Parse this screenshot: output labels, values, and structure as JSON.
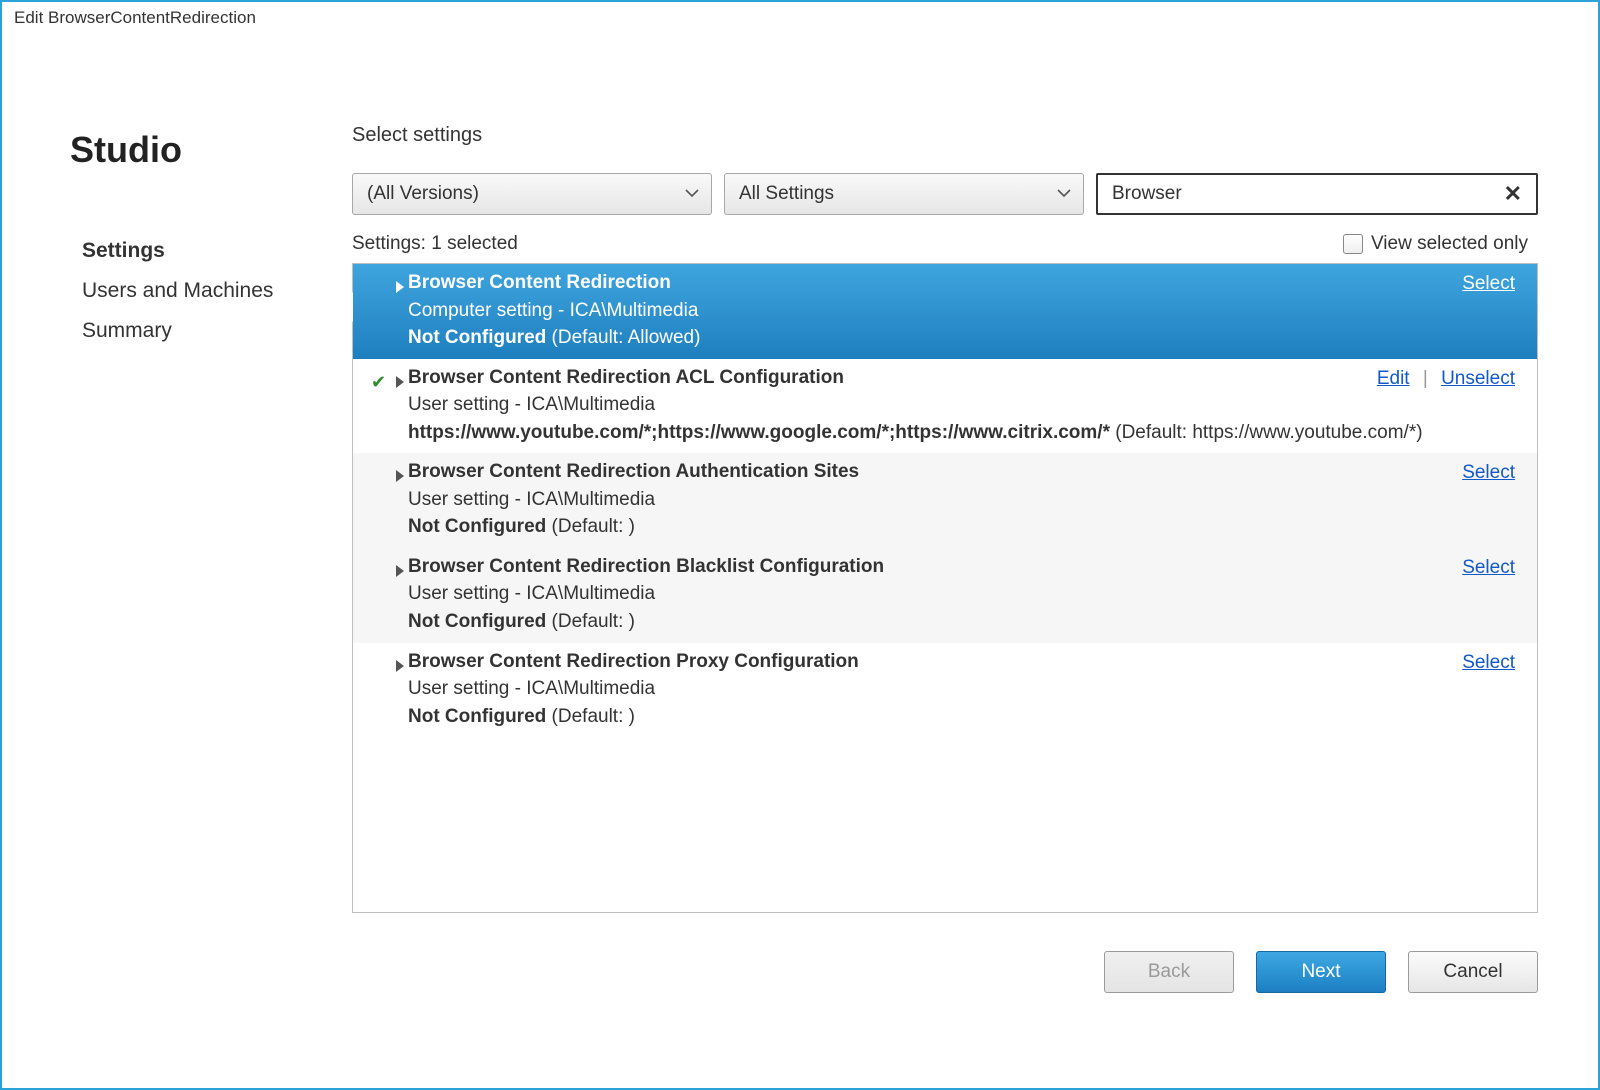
{
  "window": {
    "title": "Edit BrowserContentRedirection"
  },
  "sidebar": {
    "brand": "Studio",
    "items": [
      {
        "label": "Settings",
        "active": true
      },
      {
        "label": "Users and Machines",
        "active": false
      },
      {
        "label": "Summary",
        "active": false
      }
    ]
  },
  "main": {
    "section_title": "Select settings",
    "version_dropdown": "(All Versions)",
    "scope_dropdown": "All Settings",
    "search_value": "Browser",
    "settings_count_label": "Settings:",
    "settings_count_value": "1 selected",
    "view_selected_only": "View selected only"
  },
  "settings": [
    {
      "selected": true,
      "checked": false,
      "title": "Browser Content Redirection",
      "sub": "Computer setting - ICA\\Multimedia",
      "status_label": "Not Configured",
      "status_default": " (Default: Allowed)",
      "action_primary": "Select",
      "action_secondary": ""
    },
    {
      "selected": false,
      "checked": true,
      "title": "Browser Content Redirection ACL Configuration",
      "sub": "User setting - ICA\\Multimedia",
      "status_label": "https://www.youtube.com/*;https://www.google.com/*;https://www.citrix.com/*",
      "status_default": " (Default: https://www.youtube.com/*)",
      "action_primary": "Unselect",
      "action_secondary": "Edit"
    },
    {
      "selected": false,
      "checked": false,
      "title": "Browser Content Redirection Authentication Sites",
      "sub": "User setting - ICA\\Multimedia",
      "status_label": "Not Configured",
      "status_default": " (Default: )",
      "action_primary": "Select",
      "action_secondary": ""
    },
    {
      "selected": false,
      "checked": false,
      "title": "Browser Content Redirection Blacklist Configuration",
      "sub": "User setting - ICA\\Multimedia",
      "status_label": "Not Configured",
      "status_default": " (Default: )",
      "action_primary": "Select",
      "action_secondary": ""
    },
    {
      "selected": false,
      "checked": false,
      "title": "Browser Content Redirection Proxy Configuration",
      "sub": "User setting - ICA\\Multimedia",
      "status_label": "Not Configured",
      "status_default": " (Default: )",
      "action_primary": "Select",
      "action_secondary": ""
    }
  ],
  "footer": {
    "back": "Back",
    "next": "Next",
    "cancel": "Cancel"
  }
}
